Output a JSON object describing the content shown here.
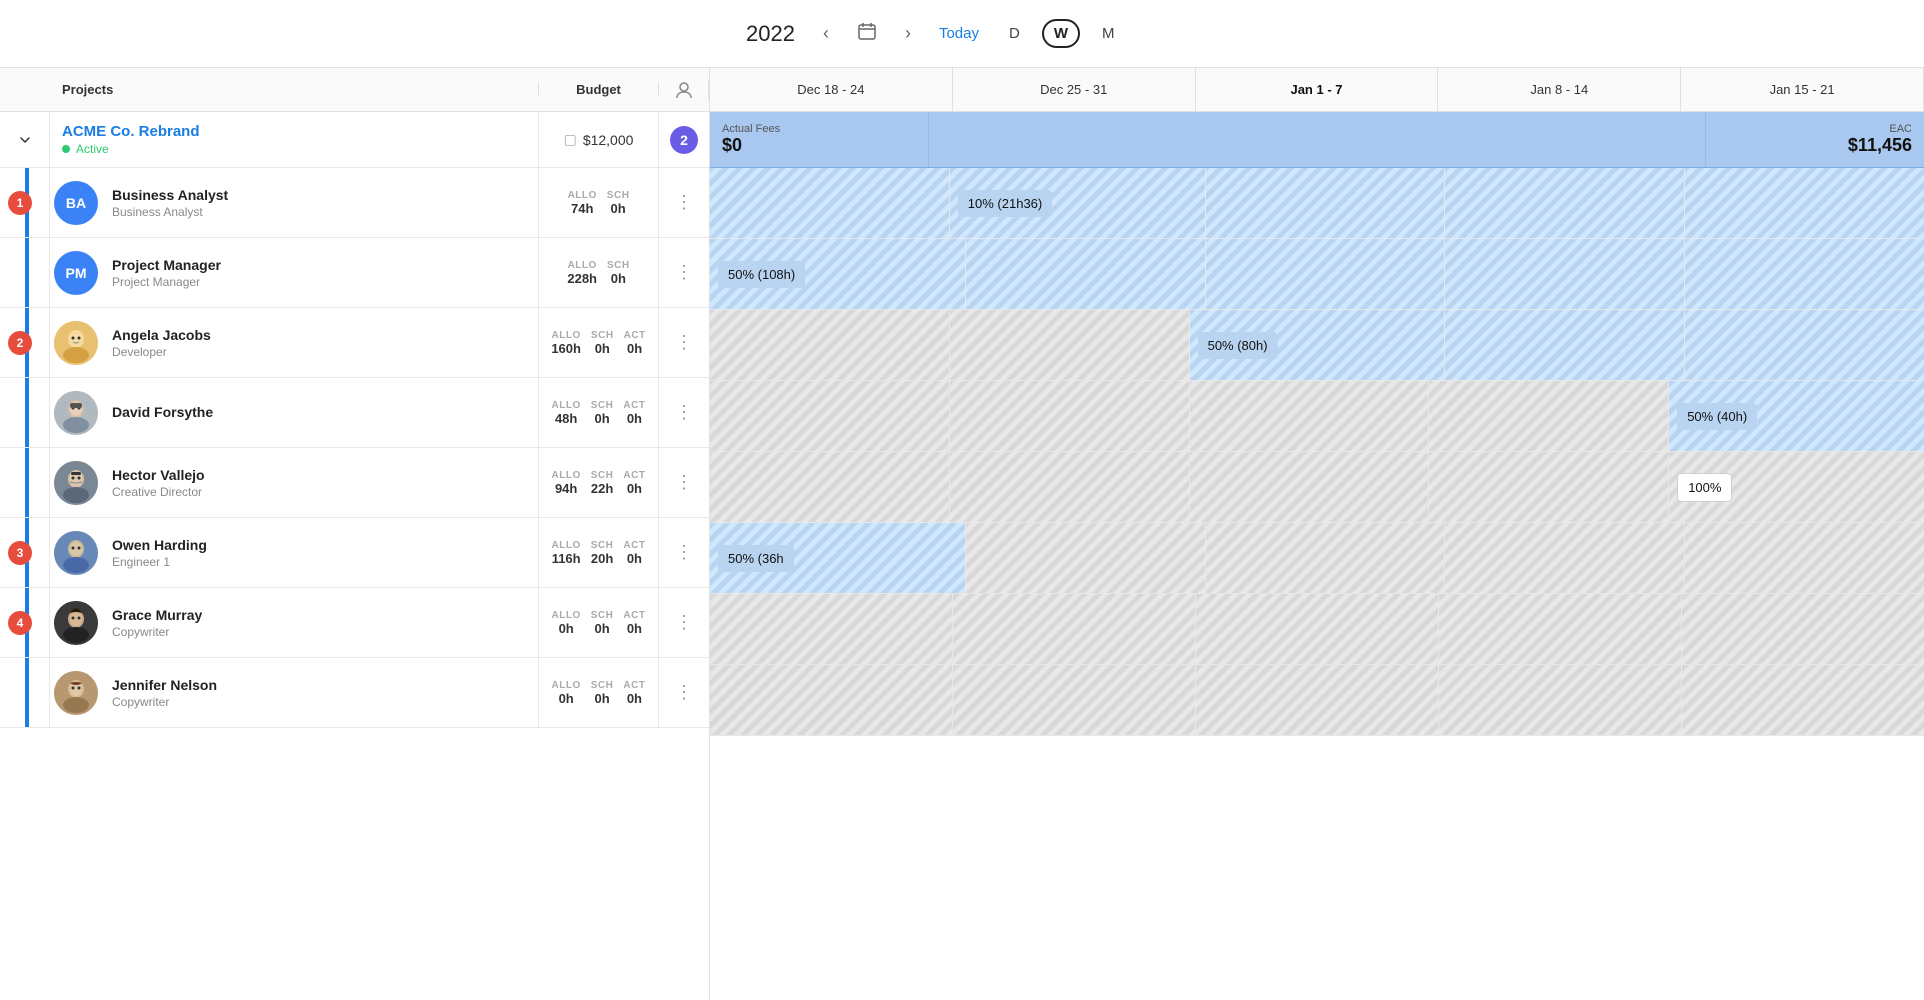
{
  "topbar": {
    "year": "2022",
    "today_label": "Today",
    "view_d": "D",
    "view_w": "W",
    "view_m": "M"
  },
  "column_headers": {
    "projects": "Projects",
    "budget": "Budget",
    "weeks": [
      "Dec 18 - 24",
      "Dec 25 - 31",
      "Jan 1 - 7",
      "Jan 8 - 14",
      "Jan 15 - 21"
    ]
  },
  "project": {
    "name": "ACME Co. Rebrand",
    "status": "Active",
    "budget": "$12,000",
    "member_count": "2",
    "actual_fees_label": "Actual Fees",
    "actual_fees_value": "$0",
    "eac_label": "EAC",
    "eac_value": "$11,456"
  },
  "milestones": [
    "1",
    "2",
    "3",
    "4"
  ],
  "resources": [
    {
      "id": "r1",
      "avatar_type": "initials",
      "initials": "BA",
      "avatar_class": "avatar-ba",
      "name": "Business Analyst",
      "role": "Business Analyst",
      "allo": "74h",
      "sch": "0h",
      "act": null,
      "milestone": null,
      "gantt_col": 2,
      "gantt_label": "10% (21h36)",
      "gantt_offset": "5px",
      "gantt_width": "95%"
    },
    {
      "id": "r2",
      "avatar_type": "initials",
      "initials": "PM",
      "avatar_class": "avatar-pm",
      "name": "Project Manager",
      "role": "Project Manager",
      "allo": "228h",
      "sch": "0h",
      "act": null,
      "milestone": null,
      "gantt_col": 2,
      "gantt_label": "50% (108h)",
      "gantt_offset": "5px",
      "gantt_width": "95%"
    },
    {
      "id": "r3",
      "avatar_type": "photo",
      "avatar_class": "avatar-aj",
      "name": "Angela Jacobs",
      "role": "Developer",
      "allo": "160h",
      "sch": "0h",
      "act": "0h",
      "milestone": "2",
      "gantt_col": 3,
      "gantt_label": "50% (80h)"
    },
    {
      "id": "r4",
      "avatar_type": "photo",
      "avatar_class": "avatar-df",
      "name": "David Forsythe",
      "role": "",
      "allo": "48h",
      "sch": "0h",
      "act": "0h",
      "milestone": null,
      "gantt_col": 4,
      "gantt_label": "50% (40h)"
    },
    {
      "id": "r5",
      "avatar_type": "photo",
      "avatar_class": "avatar-hv",
      "name": "Hector Vallejo",
      "role": "Creative Director",
      "allo": "94h",
      "sch": "22h",
      "act": "0h",
      "milestone": null,
      "gantt_col": 4,
      "gantt_label": "100%"
    },
    {
      "id": "r6",
      "avatar_type": "photo",
      "avatar_class": "avatar-oh",
      "name": "Owen Harding",
      "role": "Engineer 1",
      "allo": "116h",
      "sch": "20h",
      "act": "0h",
      "milestone": "3",
      "gantt_col": 1,
      "gantt_label": "50% (36h"
    },
    {
      "id": "r7",
      "avatar_type": "photo",
      "avatar_class": "avatar-gm",
      "name": "Grace Murray",
      "role": "Copywriter",
      "allo": "0h",
      "sch": "0h",
      "act": "0h",
      "milestone": "4",
      "gantt_col": 0,
      "gantt_label": ""
    },
    {
      "id": "r8",
      "avatar_type": "photo",
      "avatar_class": "avatar-jn",
      "name": "Jennifer Nelson",
      "role": "Copywriter",
      "allo": "0h",
      "sch": "0h",
      "act": "0h",
      "milestone": null,
      "gantt_col": 0,
      "gantt_label": ""
    }
  ],
  "labels": {
    "allo": "ALLO",
    "sch": "SCH",
    "act": "ACT"
  }
}
